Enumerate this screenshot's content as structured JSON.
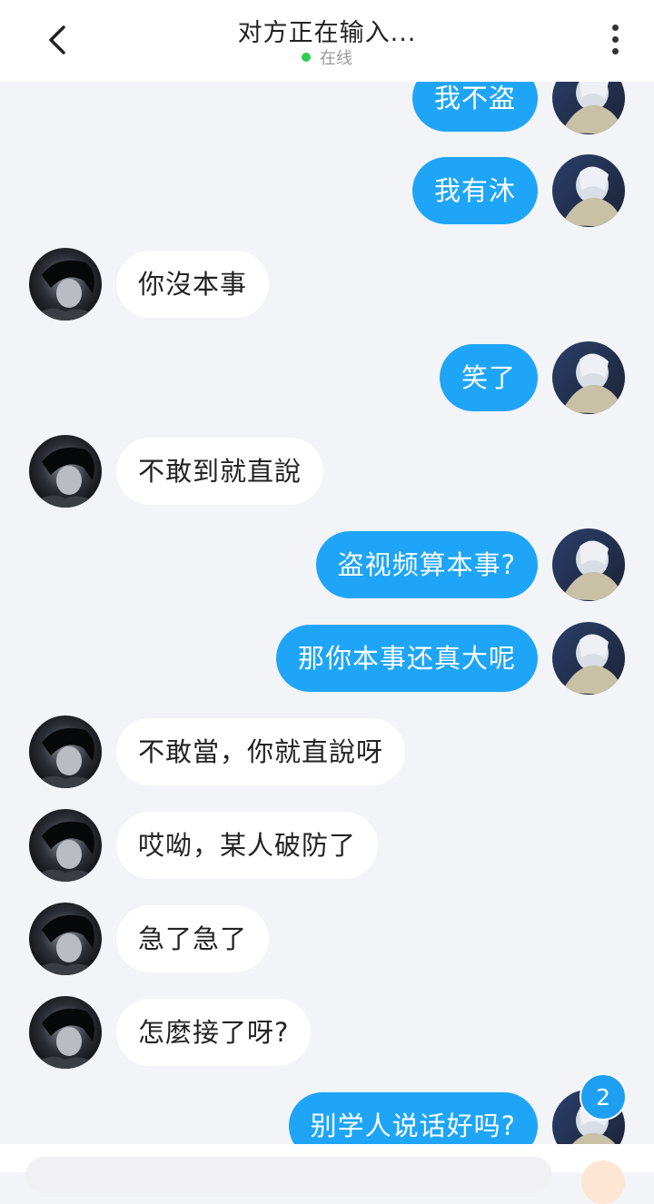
{
  "header": {
    "title": "对方正在输入...",
    "status": "在线",
    "status_color": "#2ecc52"
  },
  "icons": {
    "back": "chevron-left-icon",
    "more": "more-vertical-icon"
  },
  "colors": {
    "my_bubble": "#1ea5f7",
    "their_bubble": "#ffffff",
    "badge": "#1e9ff2"
  },
  "messages": [
    {
      "from": "me",
      "text": "我不盗"
    },
    {
      "from": "me",
      "text": "我有沐"
    },
    {
      "from": "them",
      "text": "你沒本事"
    },
    {
      "from": "me",
      "text": "笑了"
    },
    {
      "from": "them",
      "text": "不敢到就直說"
    },
    {
      "from": "me",
      "text": "盗视频算本事?"
    },
    {
      "from": "me",
      "text": "那你本事还真大呢"
    },
    {
      "from": "them",
      "text": "不敢當，你就直說呀"
    },
    {
      "from": "them",
      "text": "哎呦，某人破防了"
    },
    {
      "from": "them",
      "text": "急了急了"
    },
    {
      "from": "them",
      "text": "怎麼接了呀?"
    },
    {
      "from": "me",
      "text": "别学人说话好吗?"
    }
  ],
  "unread_badge": "2"
}
